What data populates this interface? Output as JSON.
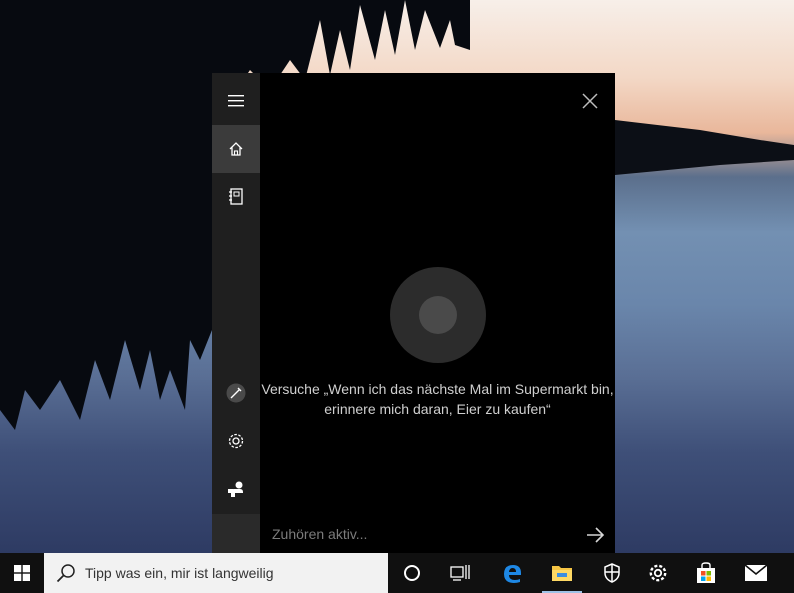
{
  "cortana": {
    "hint_line1": "Versuche „Wenn ich das nächste Mal im Supermarkt bin,",
    "hint_line2": "erinnere mich daran, Eier zu kaufen“",
    "listening_text": "Zuhören aktiv...",
    "sidebar": [
      {
        "name": "menu",
        "icon": "hamburger-icon"
      },
      {
        "name": "home",
        "icon": "home-icon",
        "active": true
      },
      {
        "name": "notebook",
        "icon": "notebook-icon"
      },
      {
        "name": "mic-setup",
        "icon": "pen-icon"
      },
      {
        "name": "settings",
        "icon": "gear-icon"
      },
      {
        "name": "feedback",
        "icon": "feedback-icon"
      }
    ]
  },
  "taskbar": {
    "search_placeholder": "Tipp was ein, mir ist langweilig",
    "icons": [
      "windows-logo-icon",
      "cortana-circle-icon",
      "task-view-icon",
      "edge-icon",
      "file-explorer-icon",
      "defender-shield-icon",
      "gear-icon",
      "store-icon",
      "mail-icon"
    ]
  },
  "colors": {
    "accent": "#0a7fd8",
    "panel_bg": "#000000",
    "sidebar_bg": "#1f1f1f"
  }
}
